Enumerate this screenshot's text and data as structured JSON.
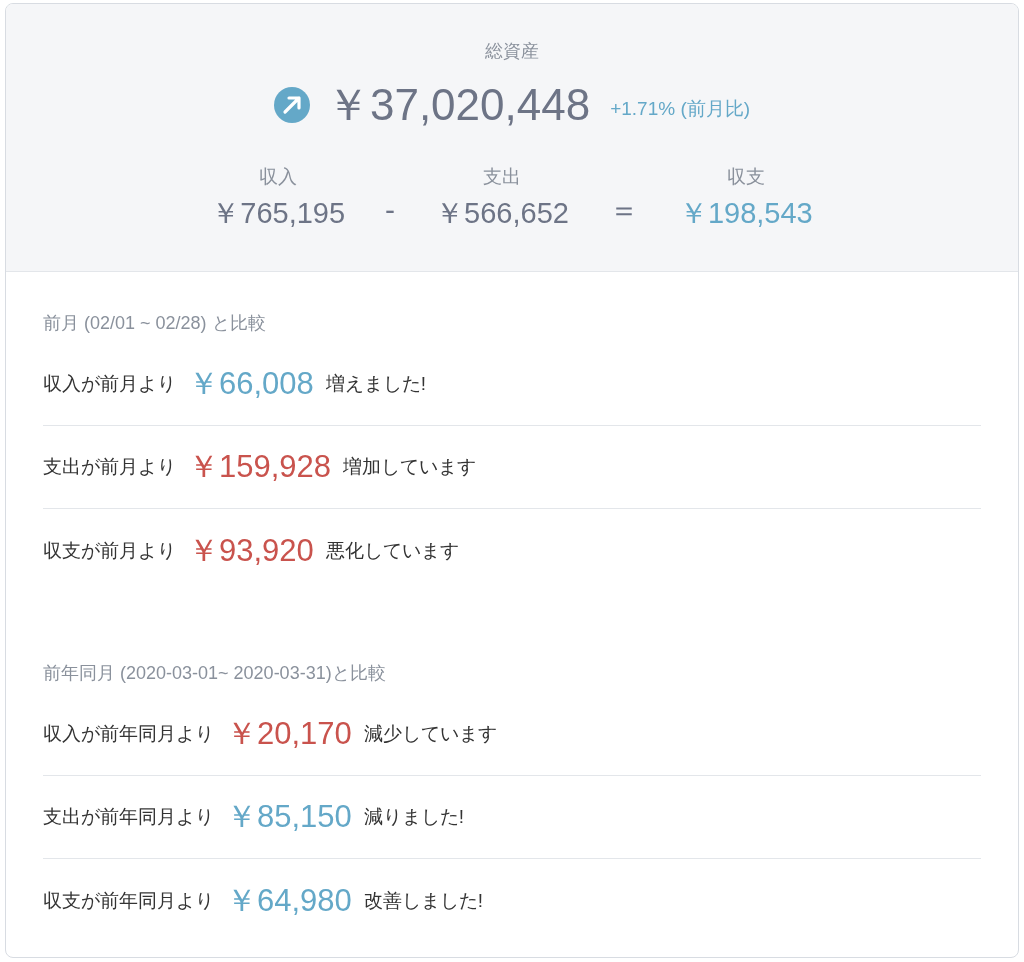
{
  "summary": {
    "title": "総資産",
    "total": "￥37,020,448",
    "change": "+1.71% (前月比)",
    "columns": [
      {
        "label": "収入",
        "value": "￥765,195",
        "color": "#6d7486"
      },
      {
        "operator": "-"
      },
      {
        "label": "支出",
        "value": "￥566,652",
        "color": "#6d7486"
      },
      {
        "operator": "＝"
      },
      {
        "label": "収支",
        "value": "￥198,543",
        "color": "#64a8c8"
      }
    ]
  },
  "comparisons": [
    {
      "title": "前月 (02/01 ~ 02/28) と比較",
      "rows": [
        {
          "prefix": "収入が前月より",
          "amount": "￥66,008",
          "suffix": "増えました!",
          "color": "#64a8c8"
        },
        {
          "prefix": "支出が前月より",
          "amount": "￥159,928",
          "suffix": "増加しています",
          "color": "#c9534d"
        },
        {
          "prefix": "収支が前月より",
          "amount": "￥93,920",
          "suffix": "悪化しています",
          "color": "#c9534d"
        }
      ]
    },
    {
      "title": "前年同月 (2020-03-01~ 2020-03-31)と比較",
      "rows": [
        {
          "prefix": "収入が前年同月より",
          "amount": "￥20,170",
          "suffix": "減少しています",
          "color": "#c9534d"
        },
        {
          "prefix": "支出が前年同月より",
          "amount": "￥85,150",
          "suffix": "減りました!",
          "color": "#64a8c8"
        },
        {
          "prefix": "収支が前年同月より",
          "amount": "￥64,980",
          "suffix": "改善しました!",
          "color": "#64a8c8"
        }
      ]
    }
  ]
}
